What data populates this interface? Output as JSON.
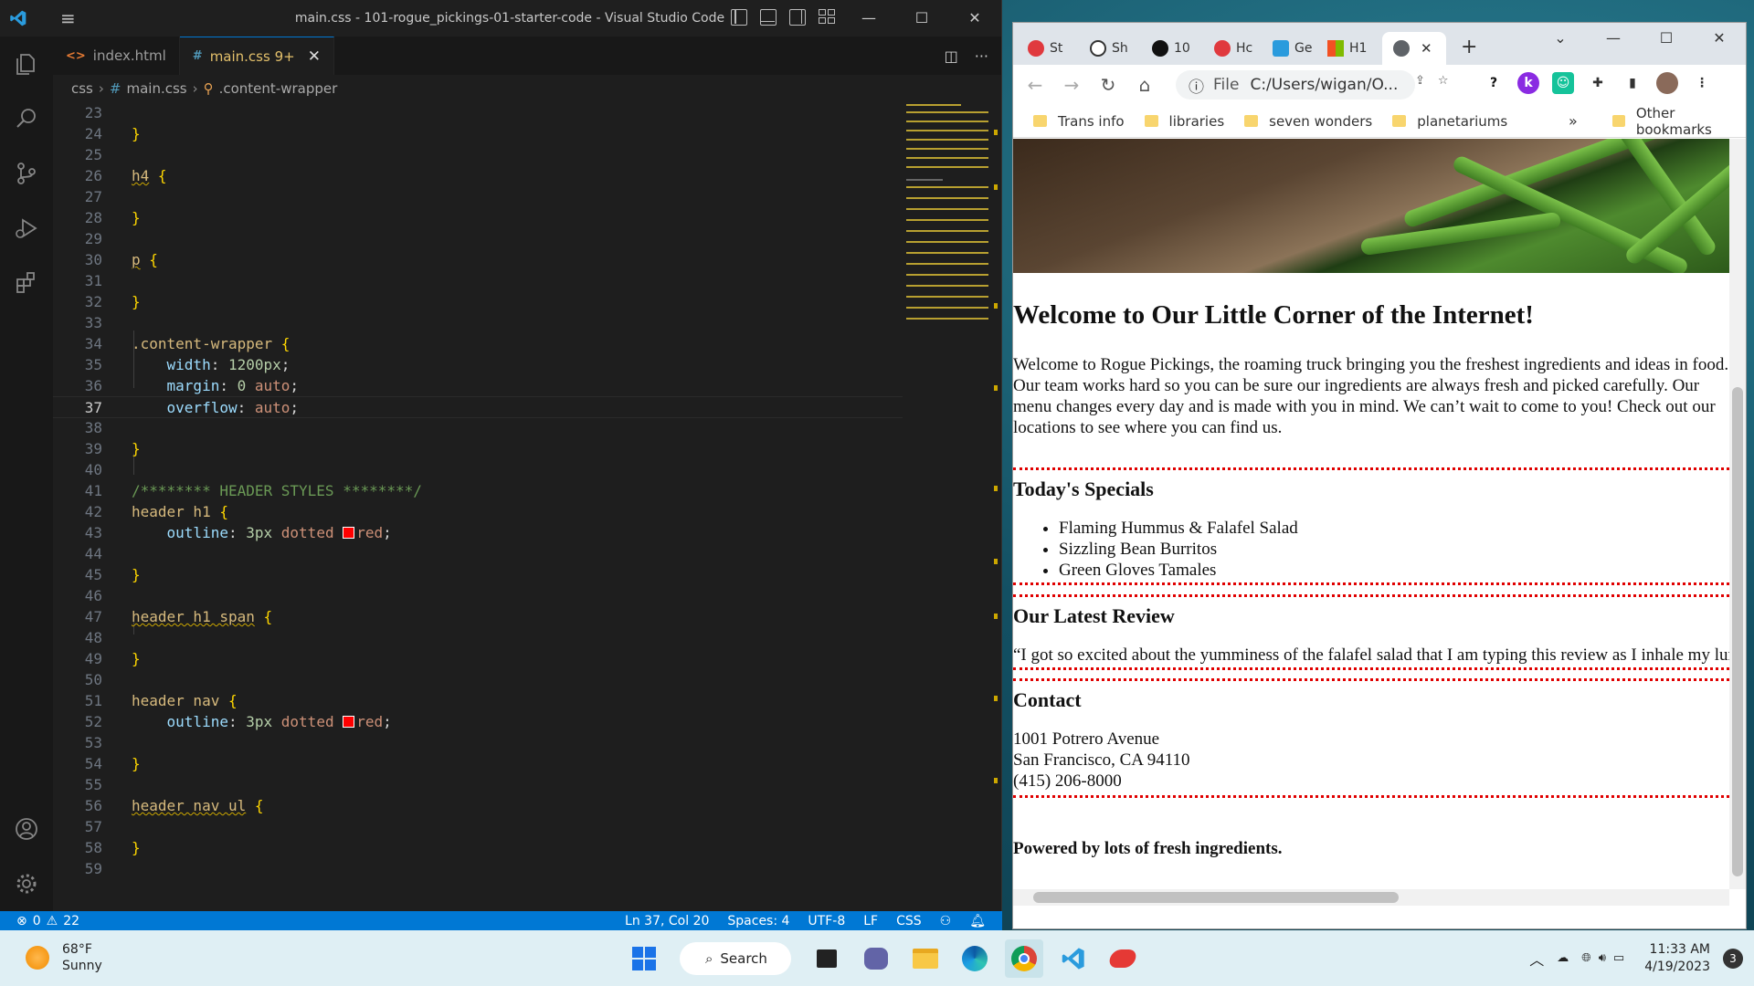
{
  "vscode": {
    "title": "main.css - 101-rogue_pickings-01-starter-code - Visual Studio Code",
    "tabs": [
      {
        "label": "index.html",
        "icon": "<>"
      },
      {
        "label": "main.css 9+",
        "icon": "#"
      }
    ],
    "breadcrumb": [
      "css",
      "main.css",
      ".content-wrapper"
    ],
    "status": {
      "errors": "0",
      "warnings": "22",
      "position": "Ln 37, Col 20",
      "spaces": "Spaces: 4",
      "encoding": "UTF-8",
      "eol": "LF",
      "language": "CSS"
    },
    "code": {
      "l23": "23",
      "l24": "24",
      "l25": "25",
      "l26": "26",
      "l27": "27",
      "l28": "28",
      "l29": "29",
      "l30": "30",
      "l31": "31",
      "l32": "32",
      "l33": "33",
      "l34": "34",
      "l35": "35",
      "l36": "36",
      "l37": "37",
      "l38": "38",
      "l39": "39",
      "l40": "40",
      "l41": "41",
      "l42": "42",
      "l43": "43",
      "l44": "44",
      "l45": "45",
      "l46": "46",
      "l47": "47",
      "l48": "48",
      "l49": "49",
      "l50": "50",
      "l51": "51",
      "l52": "52",
      "l53": "53",
      "l54": "54",
      "l55": "55",
      "l56": "56",
      "l57": "57",
      "l58": "58",
      "l59": "59",
      "h4": "h4",
      "p": "p",
      "content_wrapper": ".content-wrapper",
      "width_prop": "width",
      "width_val": "1200px",
      "margin_prop": "margin",
      "margin_num": "0",
      "margin_val": "auto",
      "overflow_prop": "overflow",
      "overflow_val": "auto",
      "comment": "/******** HEADER STYLES ********/",
      "header_h1": "header h1",
      "outline_prop": "outline",
      "outline_num": "3px",
      "outline_style": "dotted",
      "outline_color": "red",
      "header_h1_span": "header h1 span",
      "header_nav": "header nav",
      "header_nav_ul": "header nav ul"
    }
  },
  "chrome": {
    "tabs": [
      "St",
      "Sh",
      "10",
      "Hc",
      "Ge",
      "H1",
      ""
    ],
    "url": "C:/Users/wigan/O...",
    "url_prefix": "File",
    "bookmarks": [
      "Trans info",
      "libraries",
      "seven wonders",
      "planetariums"
    ],
    "bookmarks_more": "»",
    "other_bookmarks": "Other bookmarks"
  },
  "page": {
    "heading": "Welcome to Our Little Corner of the Internet!",
    "intro": "Welcome to Rogue Pickings, the roaming truck bringing you the freshest ingredients and ideas in food. Our team works hard so you can be sure our ingredients are always fresh and picked carefully. Our menu changes every day and is made with you in mind. We can’t wait to come to you! Check out our locations to see where you can find us.",
    "specials_title": "Today's Specials",
    "specials": [
      "Flaming Hummus & Falafel Salad",
      "Sizzling Bean Burritos",
      "Green Gloves Tamales"
    ],
    "review_title": "Our Latest Review",
    "review": "“I got so excited about the yumminess of the falafel salad that I am typing this review as I inhale my lunch!”",
    "contact_title": "Contact",
    "address1": "1001 Potrero Avenue",
    "address2": "San Francisco, CA 94110",
    "phone": "(415) 206-8000",
    "footer": "Powered by lots of fresh ingredients."
  },
  "taskbar": {
    "temp": "68°F",
    "condition": "Sunny",
    "search": "Search",
    "time": "11:33 AM",
    "date": "4/19/2023",
    "notifications": "3"
  }
}
